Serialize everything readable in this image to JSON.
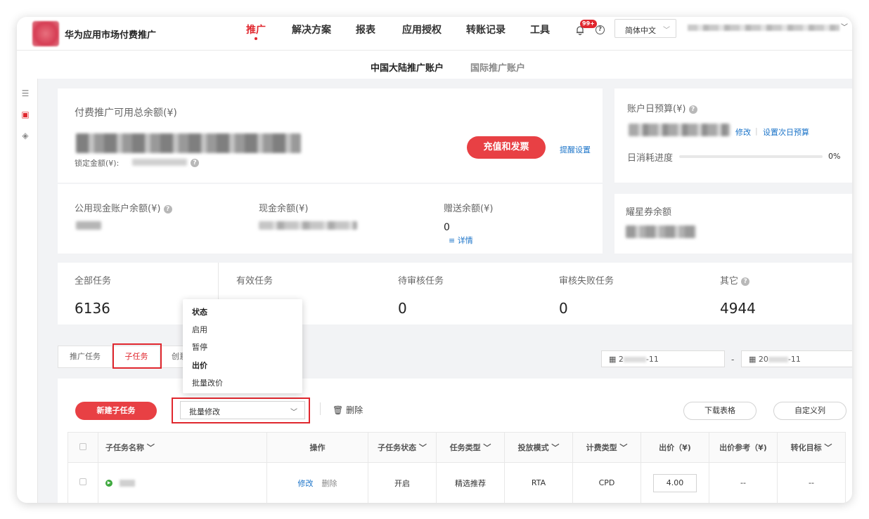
{
  "header": {
    "brand": "华为应用市场付费推广",
    "nav": [
      "推广",
      "解决方案",
      "报表",
      "应用授权",
      "转账记录",
      "工具"
    ],
    "badge": "99+",
    "lang": "简体中文"
  },
  "subtabs": [
    "中国大陆推广账户",
    "国际推广账户"
  ],
  "balance": {
    "title": "付费推广可用总余额(¥)",
    "locked_label": "锁定金额(¥):",
    "recharge_button": "充值和发票",
    "reminder_link": "提醒设置",
    "public_cash_label": "公用现金账户余额(¥)",
    "cash_label": "现金余额(¥)",
    "gift_label": "赠送余额(¥)",
    "gift_value": "0",
    "details_link": "详情"
  },
  "budget": {
    "title": "账户日预算(¥)",
    "modify_link": "修改",
    "next_day_link": "设置次日预算",
    "progress_label": "日消耗进度",
    "progress_value": "0%",
    "progress_fraction": 0
  },
  "coupon": {
    "title": "耀星券余额"
  },
  "stats": [
    {
      "label": "全部任务",
      "value": "6136"
    },
    {
      "label": "有效任务",
      "value": ""
    },
    {
      "label": "待审核任务",
      "value": "0"
    },
    {
      "label": "审核失败任务",
      "value": "0"
    },
    {
      "label": "其它",
      "value": "4944"
    }
  ],
  "task_tabs": [
    "推广任务",
    "子任务",
    "创意"
  ],
  "date_range": {
    "start": "2",
    "start_suffix": "-11",
    "sep": "-",
    "end": "20",
    "end_suffix": "-11"
  },
  "dropdown": {
    "items": [
      {
        "text": "状态",
        "header": true
      },
      {
        "text": "启用",
        "header": false
      },
      {
        "text": "暂停",
        "header": false
      },
      {
        "text": "出价",
        "header": true
      },
      {
        "text": "批量改价",
        "header": false
      }
    ]
  },
  "toolbar": {
    "new_subtask": "新建子任务",
    "batch_select": "批量修改",
    "delete": "删除",
    "download": "下载表格",
    "custom_cols": "自定义列"
  },
  "table": {
    "headers": [
      "子任务名称",
      "操作",
      "子任务状态",
      "任务类型",
      "投放模式",
      "计费类型",
      "出价（¥)",
      "出价参考（¥)",
      "转化目标"
    ],
    "row": {
      "ops_modify": "修改",
      "ops_delete": "删除",
      "status": "开启",
      "task_type": "精选推荐",
      "mode": "RTA",
      "billing": "CPD",
      "price": "4.00",
      "ref": "--",
      "goal": "--"
    }
  },
  "colors": {
    "accent": "#e0272e",
    "link": "#1a73c8"
  }
}
